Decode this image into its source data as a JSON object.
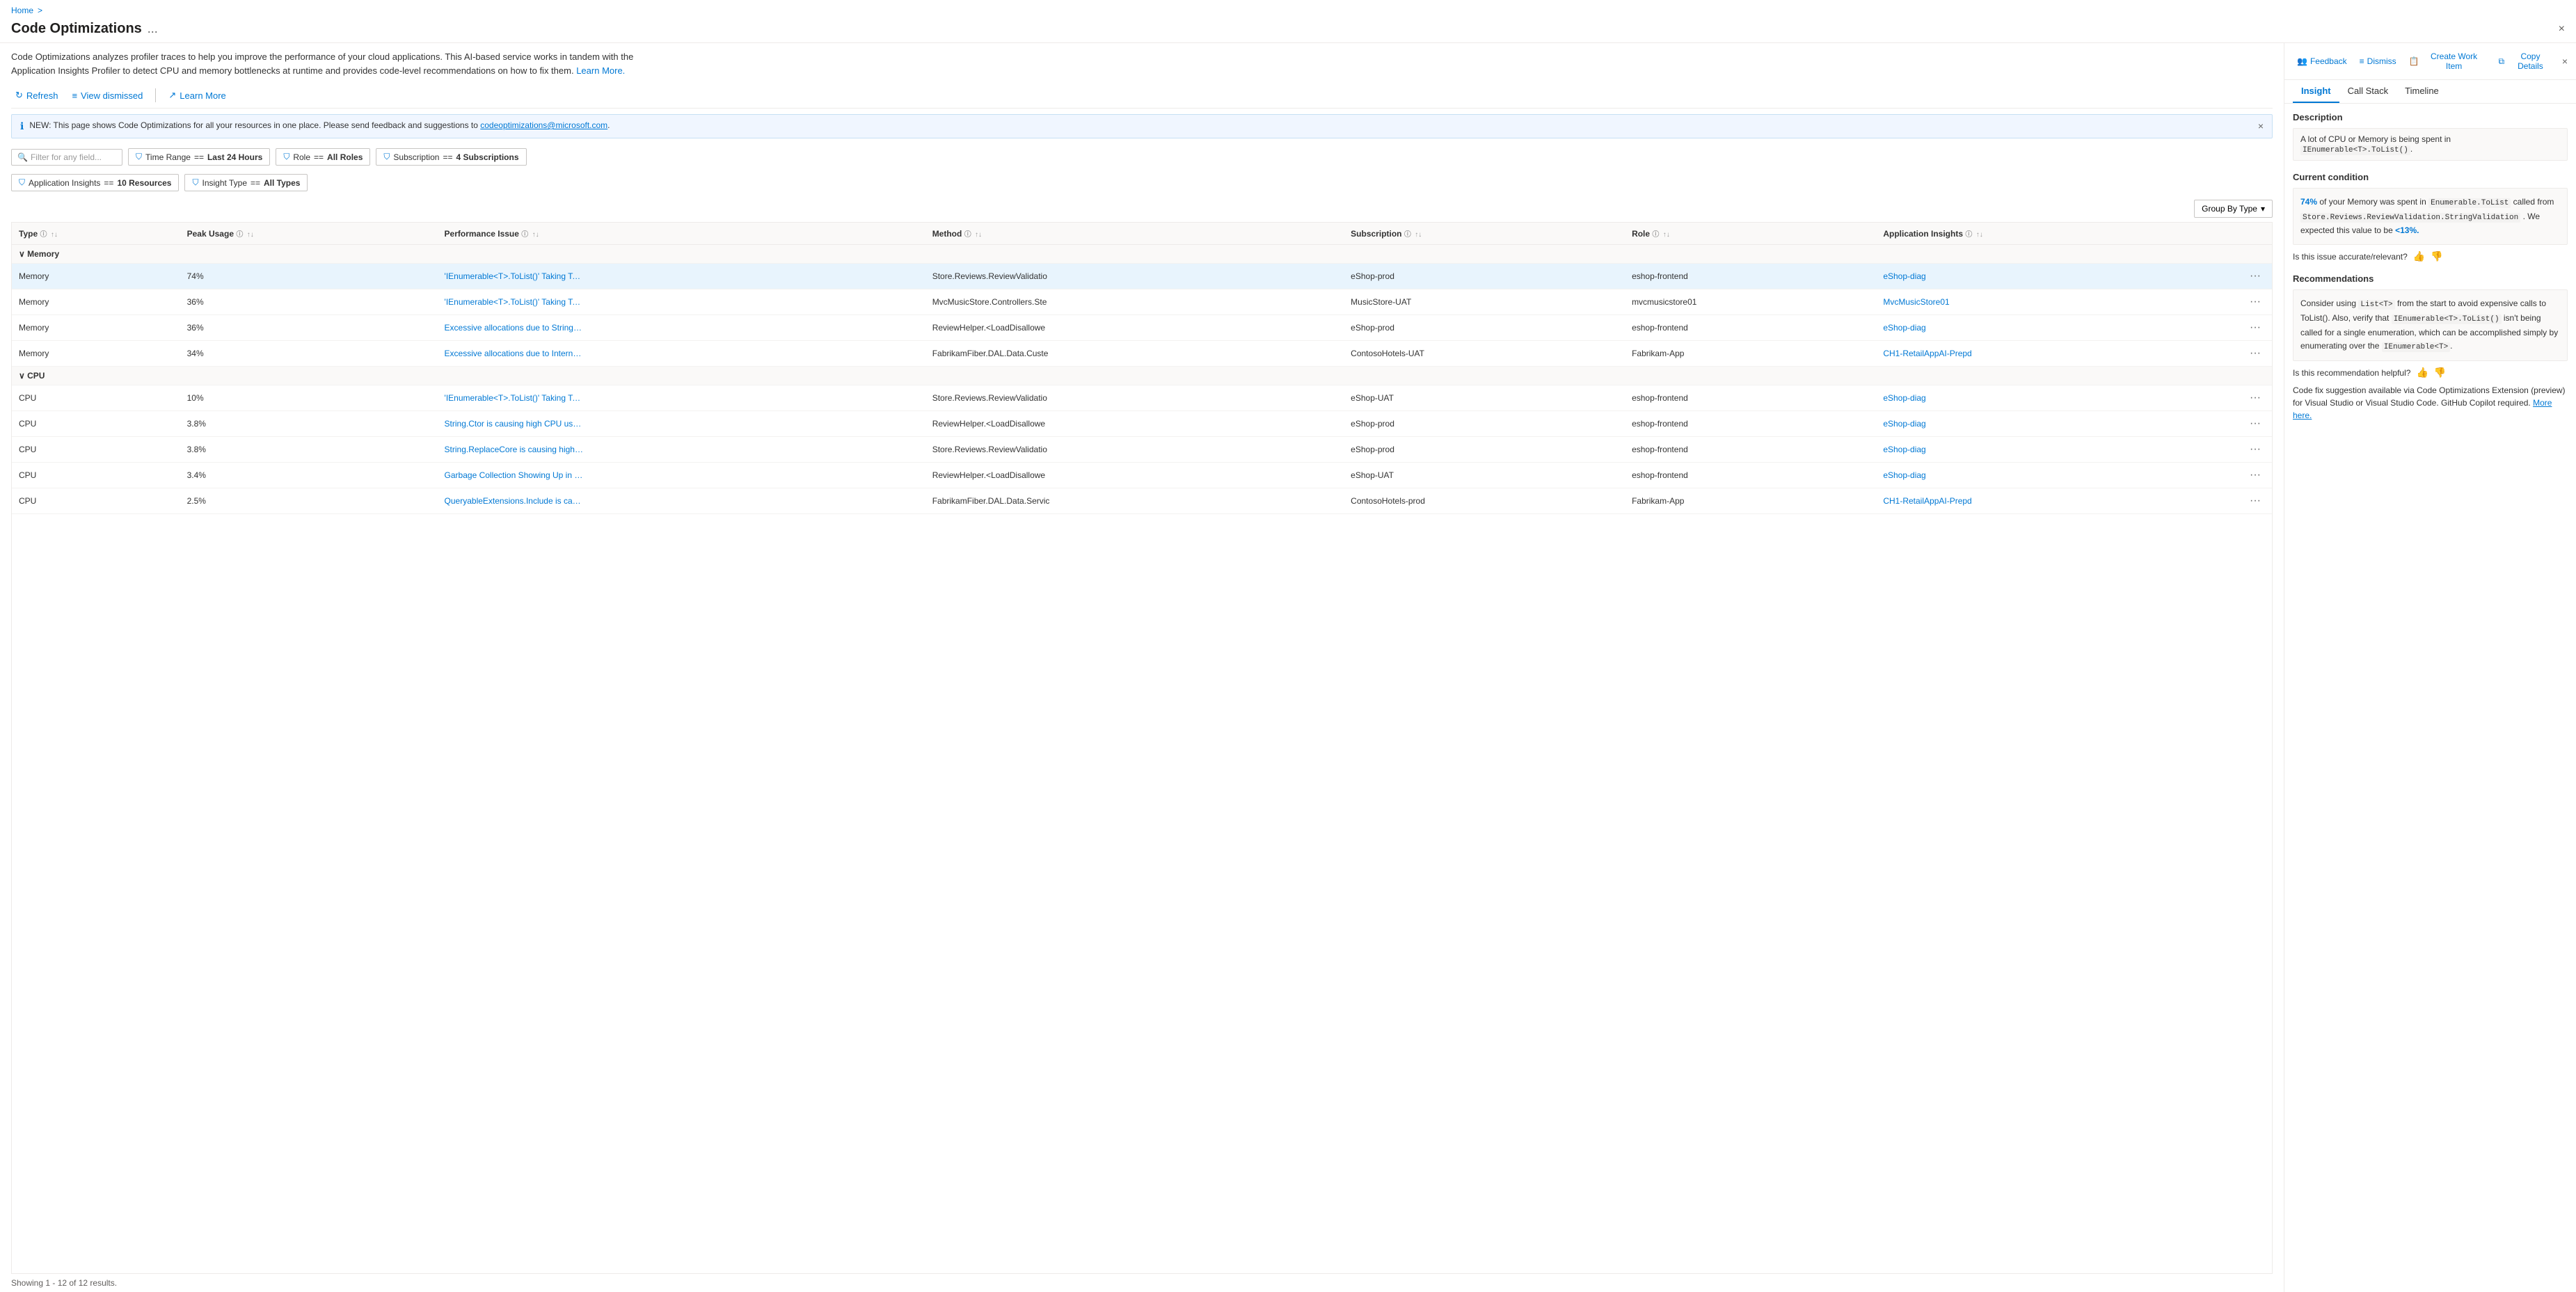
{
  "breadcrumb": {
    "home": "Home",
    "separator": ">"
  },
  "header": {
    "title": "Code Optimizations",
    "ellipsis": "...",
    "close_label": "×"
  },
  "description": {
    "text": "Code Optimizations analyzes profiler traces to help you improve the performance of your cloud applications. This AI-based service works in tandem with the Application Insights Profiler to detect CPU and memory bottlenecks at runtime and provides code-level recommendations on how to fix them.",
    "link_text": "Learn More.",
    "link_url": "#"
  },
  "toolbar": {
    "refresh_label": "Refresh",
    "view_dismissed_label": "View dismissed",
    "learn_more_label": "Learn More"
  },
  "banner": {
    "text": "NEW: This page shows Code Optimizations for all your resources in one place. Please send feedback and suggestions to",
    "email": "codeoptimizations@microsoft.com",
    "close": "×"
  },
  "filters": {
    "placeholder": "Filter for any field...",
    "time_range_label": "Time Range",
    "time_range_value": "Last 24 Hours",
    "role_label": "Role",
    "role_value": "All Roles",
    "subscription_label": "Subscription",
    "subscription_value": "4 Subscriptions",
    "app_insights_label": "Application Insights",
    "app_insights_value": "10 Resources",
    "insight_type_label": "Insight Type",
    "insight_type_value": "All Types"
  },
  "group_by": {
    "label": "Group By Type",
    "chevron": "▾"
  },
  "table": {
    "columns": [
      {
        "id": "type",
        "label": "Type"
      },
      {
        "id": "peak_usage",
        "label": "Peak Usage"
      },
      {
        "id": "performance_issue",
        "label": "Performance Issue"
      },
      {
        "id": "method",
        "label": "Method"
      },
      {
        "id": "subscription",
        "label": "Subscription"
      },
      {
        "id": "role",
        "label": "Role"
      },
      {
        "id": "app_insights",
        "label": "Application Insights"
      }
    ],
    "groups": [
      {
        "name": "Memory",
        "rows": [
          {
            "type": "Memory",
            "peak": "74%",
            "issue": "'IEnumerable<T>.ToList()' Taking Too M",
            "method": "Store.Reviews.ReviewValidatio",
            "subscription": "eShop-prod",
            "role": "eshop-frontend",
            "app_insights": "eShop-diag",
            "selected": true
          },
          {
            "type": "Memory",
            "peak": "36%",
            "issue": "'IEnumerable<T>.ToList()' Taking Too M",
            "method": "MvcMusicStore.Controllers.Ste",
            "subscription": "MusicStore-UAT",
            "role": "mvcmusicstore01",
            "app_insights": "MvcMusicStore01",
            "selected": false
          },
          {
            "type": "Memory",
            "peak": "36%",
            "issue": "Excessive allocations due to String.Ctor",
            "method": "ReviewHelper.<LoadDisallowe",
            "subscription": "eShop-prod",
            "role": "eshop-frontend",
            "app_insights": "eShop-diag",
            "selected": false
          },
          {
            "type": "Memory",
            "peak": "34%",
            "issue": "Excessive allocations due to InternalSet",
            "method": "FabrikamFiber.DAL.Data.Custe",
            "subscription": "ContosoHotels-UAT",
            "role": "Fabrikam-App",
            "app_insights": "CH1-RetailAppAI-Prepd",
            "selected": false
          }
        ]
      },
      {
        "name": "CPU",
        "rows": [
          {
            "type": "CPU",
            "peak": "10%",
            "issue": "'IEnumerable<T>.ToList()' Taking Too M",
            "method": "Store.Reviews.ReviewValidatio",
            "subscription": "eShop-UAT",
            "role": "eshop-frontend",
            "app_insights": "eShop-diag",
            "selected": false
          },
          {
            "type": "CPU",
            "peak": "3.8%",
            "issue": "String.Ctor is causing high CPU usage",
            "method": "ReviewHelper.<LoadDisallowe",
            "subscription": "eShop-prod",
            "role": "eshop-frontend",
            "app_insights": "eShop-diag",
            "selected": false
          },
          {
            "type": "CPU",
            "peak": "3.8%",
            "issue": "String.ReplaceCore is causing high CPL",
            "method": "Store.Reviews.ReviewValidatio",
            "subscription": "eShop-prod",
            "role": "eshop-frontend",
            "app_insights": "eShop-diag",
            "selected": false
          },
          {
            "type": "CPU",
            "peak": "3.4%",
            "issue": "Garbage Collection Showing Up in CPL",
            "method": "ReviewHelper.<LoadDisallowe",
            "subscription": "eShop-UAT",
            "role": "eshop-frontend",
            "app_insights": "eShop-diag",
            "selected": false
          },
          {
            "type": "CPU",
            "peak": "2.5%",
            "issue": "QueryableExtensions.Include is causing",
            "method": "FabrikamFiber.DAL.Data.Servic",
            "subscription": "ContosoHotels-prod",
            "role": "Fabrikam-App",
            "app_insights": "CH1-RetailAppAI-Prepd",
            "selected": false
          }
        ]
      }
    ]
  },
  "footer": {
    "text": "Showing 1 - 12 of 12 results."
  },
  "right_panel": {
    "header_buttons": {
      "feedback": "Feedback",
      "dismiss": "Dismiss",
      "create_work_item": "Create Work Item",
      "copy_details": "Copy Details"
    },
    "tabs": [
      {
        "id": "insight",
        "label": "Insight",
        "active": true
      },
      {
        "id": "call_stack",
        "label": "Call Stack",
        "active": false
      },
      {
        "id": "timeline",
        "label": "Timeline",
        "active": false
      }
    ],
    "insight": {
      "description_title": "Description",
      "description_text": "A lot of CPU or Memory is being spent in IEnumerable<T>.ToList().",
      "current_condition_title": "Current condition",
      "condition_text_1": "74% of your Memory was spent in",
      "condition_code1": "Enumerable.ToList",
      "condition_text_2": "called from",
      "condition_code2": "Store.Reviews.ReviewValidation.StringValidation",
      "condition_text_3": ". We expected this value to be",
      "condition_expected": "<13%.",
      "feedback_question": "Is this issue accurate/relevant?",
      "recommendations_title": "Recommendations",
      "recommendation_text": "Consider using List<T> from the start to avoid expensive calls to ToList(). Also, verify that IEnumerable<T>.ToList() isn't being called for a single enumeration, which can be accomplished simply by enumerating over the IEnumerable<T>.",
      "recommendation_question": "Is this recommendation helpful?",
      "code_fix_text": "Code fix suggestion available via Code Optimizations Extension (preview) for Visual Studio or Visual Studio Code. GitHub Copilot required.",
      "code_fix_link": "More here."
    }
  },
  "icons": {
    "refresh": "↻",
    "view_dismissed": "≡",
    "learn_more": "↗",
    "filter": "⛉",
    "info": "ℹ",
    "sort_asc": "↑",
    "sort_desc": "↓",
    "chevron_down": "▾",
    "chevron_right": "›",
    "collapse": "∨",
    "feedback_icon": "👥",
    "dismiss_icon": "≡",
    "work_item_icon": "📋",
    "copy_icon": "⧉",
    "thumb_up": "👍",
    "thumb_down": "👎",
    "info_blue": "ℹ"
  }
}
